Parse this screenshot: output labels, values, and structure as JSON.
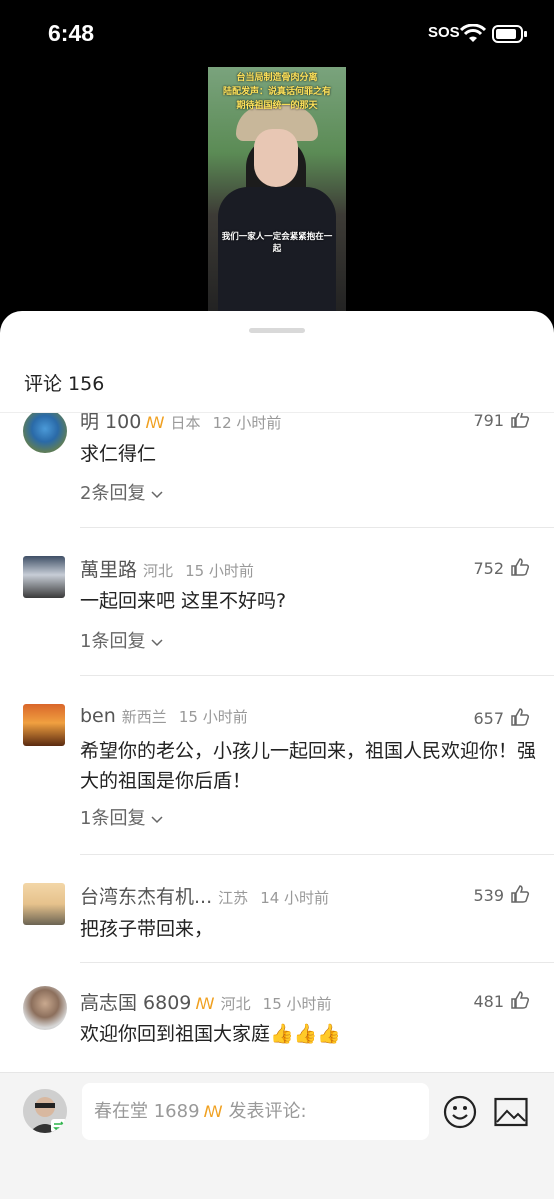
{
  "status_bar": {
    "time": "6:48",
    "sos": "SOS"
  },
  "video": {
    "caption_top_line1": "台当局制造骨肉分离",
    "caption_top_line2": "陆配发声：说真话何罪之有",
    "caption_top_line3": "期待祖国统一的那天",
    "caption_bottom": "我们一家人一定会紧紧抱在一起"
  },
  "sheet": {
    "title": "评论 156"
  },
  "comments": [
    {
      "name": "明 100",
      "badge": "ꟿ",
      "location": "日本",
      "time": "12 小时前",
      "likes": "791",
      "text": "求仁得仁",
      "replies": "2条回复"
    },
    {
      "name": "萬里路",
      "badge": "",
      "location": "河北",
      "time": "15 小时前",
      "likes": "752",
      "text": "一起回来吧 这里不好吗?",
      "replies": "1条回复"
    },
    {
      "name": "ben",
      "badge": "",
      "location": "新西兰",
      "time": "15 小时前",
      "likes": "657",
      "text": "希望你的老公，小孩儿一起回来，祖国人民欢迎你！强大的祖国是你后盾！",
      "replies": "1条回复"
    },
    {
      "name": "台湾东杰有机...",
      "badge": "",
      "location": "江苏",
      "time": "14 小时前",
      "likes": "539",
      "text": "把孩子带回来，",
      "replies": ""
    },
    {
      "name": "高志国 6809",
      "badge": "ꟿ",
      "location": "河北",
      "time": "15 小时前",
      "likes": "481",
      "text": "欢迎你回到祖国大家庭👍👍👍",
      "replies": ""
    }
  ],
  "composer": {
    "username": "春在堂 1689",
    "badge": "ꟿ",
    "placeholder": "发表评论:"
  },
  "icons": {
    "like": "thumbs-up-icon",
    "chevron": "chevron-down-icon",
    "emoji": "emoji-icon",
    "image": "image-icon"
  }
}
